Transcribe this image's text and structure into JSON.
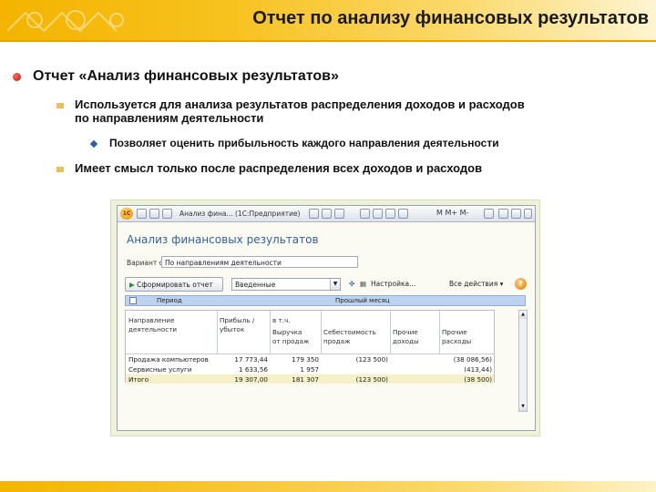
{
  "slide": {
    "title": "Отчет по анализу финансовых результатов",
    "bullet1": "Отчет «Анализ финансовых результатов»",
    "bullet2_line1": "Используется для анализа результатов распределения доходов и расходов",
    "bullet2_line2": "по направлениям деятельности",
    "bullet3": "Позволяет оценить прибыльность каждого направления деятельности",
    "bullet4": "Имеет смысл только после распределения всех доходов и расходов"
  },
  "app": {
    "window_title": "Анализ фина... (1С:Предприятие)",
    "toolbar_right": "M  M+  M-",
    "form_title": "Анализ финансовых результатов",
    "option_label": "Вариант отчета:",
    "option_value": "По направлениям деятельности",
    "generate_button": "Сформировать отчет",
    "combo_value": "Введенные",
    "settings_button": "Настройка...",
    "all_actions": "Все действия ▾",
    "help": "?",
    "filter_label1": "Период",
    "filter_label2": "Прошлый месяц",
    "columns": {
      "direction": [
        "Направление",
        "деятельности"
      ],
      "profit": [
        "Прибыль /",
        "убыток"
      ],
      "incl": [
        "в т.ч."
      ],
      "revenue": [
        "Выручка",
        "от продаж"
      ],
      "cost": [
        "Себестоимость",
        "продаж"
      ],
      "other_income": [
        "Прочие",
        "доходы"
      ],
      "other_expense": [
        "Прочие",
        "расходы"
      ]
    },
    "rows": [
      {
        "direction": "Продажа компьютеров",
        "profit": "17 773,44",
        "revenue": "179 350",
        "cost": "(123 500)",
        "other_income": "",
        "other_expense": "(38 086,56)"
      },
      {
        "direction": "Сервисные услуги",
        "profit": "1 633,56",
        "revenue": "1 957",
        "cost": "",
        "other_income": "",
        "other_expense": "(413,44)"
      },
      {
        "direction": "Итого",
        "profit": "19 307,00",
        "revenue": "181 307",
        "cost": "(123 500)",
        "other_income": "",
        "other_expense": "(38 500)"
      }
    ]
  },
  "colors": {
    "accent": "#f4b400",
    "form_title": "#2f5f9c",
    "bullet_red": "#c0140c"
  }
}
